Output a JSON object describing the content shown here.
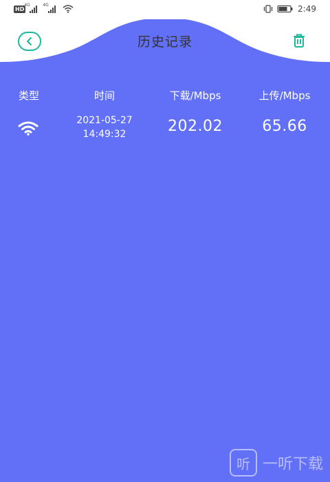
{
  "status_bar": {
    "left_badge": "HD",
    "sim1_tag": "4G",
    "sim2_tag": "4G",
    "time": "2:49"
  },
  "header": {
    "back_icon": "chevron-left-icon",
    "title": "历史记录",
    "delete_icon": "trash-icon"
  },
  "table": {
    "headers": [
      "类型",
      "时间",
      "下载/Mbps",
      "上传/Mbps"
    ],
    "rows": [
      {
        "type_icon": "wifi-icon",
        "date": "2021-05-27",
        "time": "14:49:32",
        "download": "202.02",
        "upload": "65.66"
      }
    ]
  },
  "watermark": {
    "logo_char": "听",
    "text": "一听下载"
  },
  "colors": {
    "background": "#6170f7",
    "accent": "#1bb89e",
    "header_bg": "#ffffff"
  }
}
